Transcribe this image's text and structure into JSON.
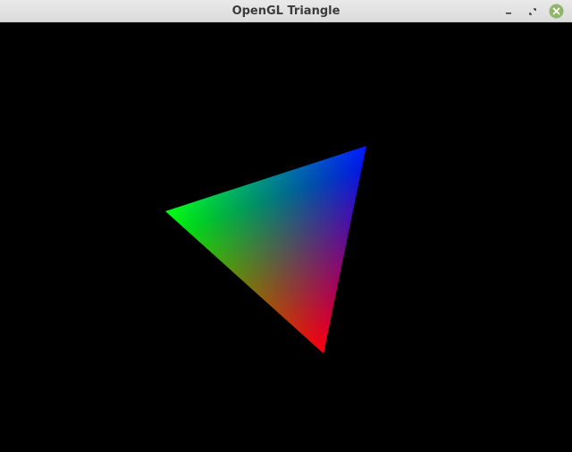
{
  "window": {
    "title": "OpenGL Triangle",
    "controls": [
      "minimize-icon",
      "restore-icon",
      "close-icon"
    ],
    "close_button_color": "#8fb56a"
  },
  "viewport": {
    "background": "#000000",
    "triangle": {
      "vertex_colors": [
        "#00ff00",
        "#0000ff",
        "#ff0000"
      ]
    }
  }
}
